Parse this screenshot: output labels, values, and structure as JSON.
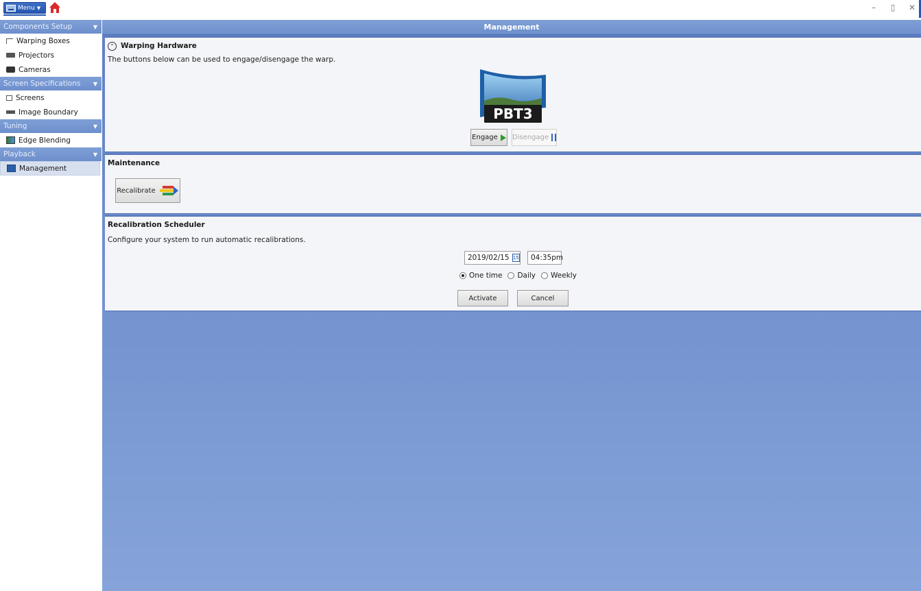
{
  "titlebar": {
    "menu_label": "Menu",
    "controls": {
      "minimize": "–",
      "restore": "▯",
      "close": "✕"
    }
  },
  "sidebar": {
    "sections": [
      {
        "title": "Components Setup",
        "items": [
          {
            "label": "Warping Boxes",
            "icon": "warping-boxes-icon"
          },
          {
            "label": "Projectors",
            "icon": "projector-icon"
          },
          {
            "label": "Cameras",
            "icon": "camera-icon"
          }
        ]
      },
      {
        "title": "Screen Specifications",
        "items": [
          {
            "label": "Screens",
            "icon": "screen-icon"
          },
          {
            "label": "Image Boundary",
            "icon": "image-boundary-icon"
          }
        ]
      },
      {
        "title": "Tuning",
        "items": [
          {
            "label": "Edge Blending",
            "icon": "edge-blending-icon"
          }
        ]
      },
      {
        "title": "Playback",
        "items": [
          {
            "label": "Management",
            "icon": "management-icon",
            "active": true
          }
        ]
      }
    ]
  },
  "main": {
    "title": "Management",
    "warping": {
      "title": "Warping Hardware",
      "description": "The buttons below can be used to engage/disengage the warp.",
      "logo_text": "PBT3",
      "engage_label": "Engage",
      "disengage_label": "Disengage"
    },
    "maintenance": {
      "title": "Maintenance",
      "recalibrate_label": "Recalibrate"
    },
    "scheduler": {
      "title": "Recalibration Scheduler",
      "description": "Configure your system to run automatic recalibrations.",
      "date": "2019/02/15",
      "calendar_day": "15",
      "time": "04:35pm",
      "options": [
        "One time",
        "Daily",
        "Weekly"
      ],
      "selected_option": "One time",
      "activate_label": "Activate",
      "cancel_label": "Cancel"
    }
  },
  "colors": {
    "header_blue": "#7496d2",
    "main_background": "#7b98d3",
    "accent": "#2556b1"
  }
}
